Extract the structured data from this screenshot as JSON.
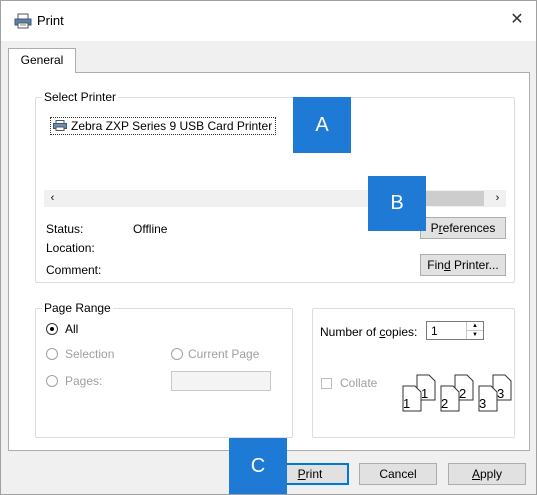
{
  "window": {
    "title": "Print",
    "close_glyph": "✕"
  },
  "tabs": [
    {
      "label": "General"
    }
  ],
  "select_printer": {
    "legend": "Select Printer",
    "printers": [
      {
        "name": "Zebra ZXP Series 9 USB Card Printer",
        "icon": "printer-icon"
      }
    ],
    "scroll_left": "‹",
    "scroll_right": "›",
    "status_label": "Status:",
    "status_value": "Offline",
    "location_label": "Location:",
    "comment_label": "Comment:",
    "preferences_pre": "P",
    "preferences_u": "r",
    "preferences_post": "eferences",
    "find_printer_pre": "Fin",
    "find_printer_u": "d",
    "find_printer_post": " Printer..."
  },
  "page_range": {
    "legend": "Page Range",
    "all_label": "All",
    "selection_label": "Selection",
    "current_page_label": "Current Page",
    "pages_label": "Pages:",
    "selected": "All"
  },
  "copies": {
    "number_label_pre": "Number of ",
    "number_label_u": "c",
    "number_label_post": "opies:",
    "value": "1",
    "collate_label": "Collate",
    "collate_checked": false,
    "collate_pages": [
      "1",
      "1",
      "2",
      "2",
      "3",
      "3"
    ]
  },
  "buttons": {
    "print_u": "P",
    "print_post": "rint",
    "cancel": "Cancel",
    "apply_u": "A",
    "apply_post": "pply"
  },
  "callouts": [
    "A",
    "B",
    "C"
  ],
  "colors": {
    "accent": "#1f7ad6",
    "default_button_border": "#0078d7"
  }
}
